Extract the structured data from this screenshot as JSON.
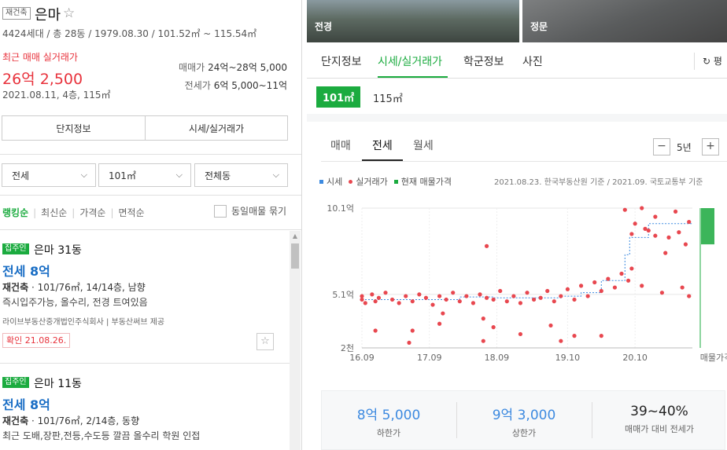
{
  "complex": {
    "tag": "재건축",
    "name": "은마",
    "info": "4424세대 / 총 28동 / 1979.08.30 / 101.52㎡ ~ 115.54㎡",
    "recent_label": "최근 매매 실거래가",
    "recent_price": "26억 2,500",
    "recent_meta": "2021.08.11, 4층, 115㎡",
    "sale_label": "매매가",
    "sale_range": "24억~28억 5,000",
    "jeonse_label": "전세가",
    "jeonse_range": "6억 5,000~11억",
    "btn_info": "단지정보",
    "btn_price": "시세/실거래가"
  },
  "filters": {
    "trade_type": "전세",
    "area": "101㎡",
    "dong": "전체동"
  },
  "sort": {
    "items": [
      "랭킹순",
      "최신순",
      "가격순",
      "면적순"
    ],
    "same_listing": "동일매물 묶기"
  },
  "listings": [
    {
      "owner_tag": "집주인",
      "name": "은마 31동",
      "price": "전세 8억",
      "desc_bold": "재건축",
      "desc": "101/76㎡, 14/14층, 남향",
      "note": "즉시입주가능, 올수리, 전경 트여있음",
      "agent": "라이브부동산중개법인주식회사 | 부동산써브 제공",
      "confirm": "확인 21.08.26."
    },
    {
      "owner_tag": "집주인",
      "name": "은마 11동",
      "price": "전세 8억",
      "desc_bold": "재건축",
      "desc": "101/76㎡, 2/14층, 동향",
      "note": "최근 도배,장판,전등,수도등 깔끔 올수리 학원 인접"
    }
  ],
  "photos": {
    "caption1": "전경",
    "caption2": "정문"
  },
  "tabs": {
    "items": [
      "단지정보",
      "시세/실거래가",
      "학군정보",
      "사진"
    ],
    "active": "시세/실거래가",
    "refresh": "평"
  },
  "area_tabs": {
    "active": "101㎡",
    "other": "115㎡"
  },
  "chart_tabs": {
    "items": [
      "매매",
      "전세",
      "월세"
    ],
    "active": "전세",
    "period": "5년",
    "minus": "−",
    "plus": "+"
  },
  "legend": {
    "items": [
      {
        "label": "시세",
        "color": "#3d8ae0"
      },
      {
        "label": "실거래가",
        "color": "#e8474f"
      },
      {
        "label": "현재 매물가격",
        "color": "#1bab3f"
      }
    ],
    "source": "2021.08.23. 한국부동산원 기준 / 2021.09. 국토교통부 기준"
  },
  "chart_data": {
    "type": "scatter",
    "title": "",
    "xlabel": "",
    "ylabel": "",
    "x_ticks": [
      "16.09",
      "17.09",
      "18.09",
      "19.10",
      "20.10",
      "매물가격"
    ],
    "y_ticks": [
      "2천",
      "5.1억",
      "10.1억"
    ],
    "ylim": [
      2000,
      10100
    ],
    "grid": true,
    "listing_range": [
      8000,
      11000
    ],
    "series": [
      {
        "name": "시세",
        "values": [
          [
            2016.75,
            4800
          ],
          [
            2017.5,
            4800
          ],
          [
            2018.2,
            4950
          ],
          [
            2018.7,
            4900
          ],
          [
            2019.4,
            4900
          ],
          [
            2019.7,
            5000
          ],
          [
            2020.0,
            5200
          ],
          [
            2020.3,
            5900
          ],
          [
            2020.65,
            7400
          ],
          [
            2020.72,
            8400
          ],
          [
            2021.0,
            9200
          ],
          [
            2021.65,
            9200
          ]
        ]
      },
      {
        "name": "실거래가",
        "values": [
          [
            2016.75,
            5000
          ],
          [
            2016.75,
            4800
          ],
          [
            2016.8,
            4600
          ],
          [
            2016.9,
            5100
          ],
          [
            2016.95,
            4700
          ],
          [
            2017.0,
            4900
          ],
          [
            2017.1,
            5200
          ],
          [
            2017.2,
            4800
          ],
          [
            2017.3,
            4600
          ],
          [
            2017.4,
            5000
          ],
          [
            2017.5,
            4700
          ],
          [
            2017.6,
            5100
          ],
          [
            2017.7,
            4900
          ],
          [
            2017.8,
            4500
          ],
          [
            2017.9,
            5000
          ],
          [
            2018.0,
            4800
          ],
          [
            2018.1,
            5200
          ],
          [
            2018.2,
            4700
          ],
          [
            2018.3,
            5000
          ],
          [
            2018.4,
            4600
          ],
          [
            2018.5,
            5100
          ],
          [
            2018.6,
            4900
          ],
          [
            2018.7,
            4800
          ],
          [
            2018.8,
            5300
          ],
          [
            2018.9,
            4700
          ],
          [
            2019.0,
            5000
          ],
          [
            2019.1,
            4600
          ],
          [
            2019.2,
            5200
          ],
          [
            2019.3,
            4800
          ],
          [
            2019.4,
            4900
          ],
          [
            2019.5,
            5300
          ],
          [
            2019.6,
            4700
          ],
          [
            2019.7,
            5000
          ],
          [
            2019.8,
            5400
          ],
          [
            2019.9,
            4800
          ],
          [
            2020.0,
            5600
          ],
          [
            2020.1,
            5000
          ],
          [
            2020.2,
            5800
          ],
          [
            2020.3,
            5300
          ],
          [
            2020.4,
            6000
          ],
          [
            2020.5,
            5500
          ],
          [
            2020.6,
            6300
          ],
          [
            2020.7,
            5900
          ],
          [
            2020.75,
            8600
          ],
          [
            2020.8,
            9200
          ],
          [
            2020.9,
            5600
          ],
          [
            2021.0,
            8800
          ],
          [
            2021.1,
            9600
          ],
          [
            2021.2,
            5200
          ],
          [
            2021.3,
            8400
          ],
          [
            2021.4,
            9900
          ],
          [
            2021.5,
            5500
          ],
          [
            2021.6,
            9300
          ],
          [
            2017.5,
            3000
          ],
          [
            2017.9,
            3400
          ],
          [
            2018.55,
            3700
          ],
          [
            2019.1,
            2800
          ],
          [
            2019.55,
            3300
          ],
          [
            2019.9,
            2700
          ],
          [
            2020.3,
            2700
          ],
          [
            2017.45,
            2300
          ],
          [
            2018.55,
            2400
          ],
          [
            2019.7,
            2400
          ],
          [
            2016.95,
            3000
          ],
          [
            2017.95,
            4000
          ],
          [
            2018.6,
            7900
          ],
          [
            2018.7,
            3200
          ],
          [
            2020.75,
            6600
          ],
          [
            2020.65,
            10000
          ],
          [
            2020.9,
            10100
          ],
          [
            2020.95,
            8900
          ],
          [
            2021.1,
            8500
          ],
          [
            2021.25,
            7500
          ],
          [
            2021.45,
            8700
          ],
          [
            2021.55,
            8000
          ],
          [
            2021.6,
            5000
          ]
        ]
      }
    ]
  },
  "summary": {
    "low_value": "8억 5,000",
    "low_label": "하한가",
    "high_value": "9억 3,000",
    "high_label": "상한가",
    "ratio_value": "39~40%",
    "ratio_label": "매매가 대비 전세가"
  }
}
